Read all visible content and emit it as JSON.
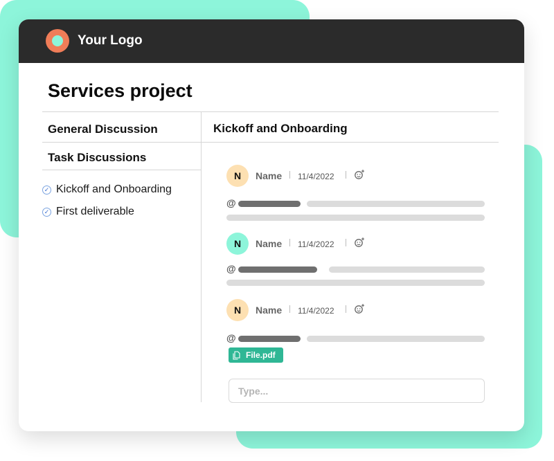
{
  "brand": {
    "logo_text": "Your Logo"
  },
  "page": {
    "title": "Services project"
  },
  "sidebar": {
    "sections": [
      {
        "label": "General Discussion"
      },
      {
        "label": "Task Discussions"
      }
    ],
    "tasks": [
      {
        "label": "Kickoff and Onboarding",
        "checked": true
      },
      {
        "label": "First deliverable",
        "checked": true
      }
    ]
  },
  "thread": {
    "title": "Kickoff and Onboarding",
    "messages": [
      {
        "avatar": "N",
        "avatar_color": "#fde0b2",
        "name": "Name",
        "date": "11/4/2022",
        "mention_symbol": "@"
      },
      {
        "avatar": "N",
        "avatar_color": "#8df5da",
        "name": "Name",
        "date": "11/4/2022",
        "mention_symbol": "@"
      },
      {
        "avatar": "N",
        "avatar_color": "#fde0b2",
        "name": "Name",
        "date": "11/4/2022",
        "mention_symbol": "@",
        "attachment": "File.pdf"
      }
    ],
    "input_placeholder": "Type..."
  },
  "colors": {
    "accent_mint": "#8df5da",
    "logo_orange": "#f07d58",
    "topbar": "#2b2b2b",
    "file_chip": "#2fb795"
  },
  "icons": [
    "logo-ring-icon",
    "check-circle-icon",
    "add-reaction-icon",
    "file-icon"
  ]
}
